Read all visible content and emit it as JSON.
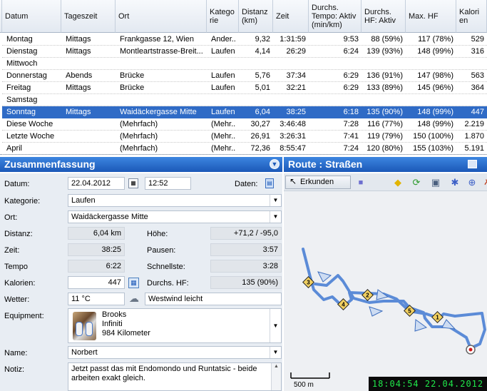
{
  "table": {
    "headers": [
      "Datum",
      "Tageszeit",
      "Ort",
      "Katego rie",
      "Distanz (km)",
      "Zeit",
      "Durchs. Tempo: Aktiv (min/km)",
      "Durchs. HF: Aktiv",
      "Max. HF",
      "Kalori en"
    ],
    "rows": [
      {
        "datum": "Montag",
        "tageszeit": "Mittags",
        "ort": "Frankgasse 12, Wien",
        "kategorie": "Ander...",
        "distanz": "9,32",
        "zeit": "1:31:59",
        "tempo": "9:53",
        "hf": "88 (59%)",
        "maxhf": "117 (78%)",
        "kal": "529"
      },
      {
        "datum": "Dienstag",
        "tageszeit": "Mittags",
        "ort": "Montleartstrasse-Breit...",
        "kategorie": "Laufen",
        "distanz": "4,14",
        "zeit": "26:29",
        "tempo": "6:24",
        "hf": "139 (93%)",
        "maxhf": "148 (99%)",
        "kal": "316"
      },
      {
        "datum": "Mittwoch",
        "tageszeit": "",
        "ort": "",
        "kategorie": "",
        "distanz": "",
        "zeit": "",
        "tempo": "",
        "hf": "",
        "maxhf": "",
        "kal": ""
      },
      {
        "datum": "Donnerstag",
        "tageszeit": "Abends",
        "ort": "Brücke",
        "kategorie": "Laufen",
        "distanz": "5,76",
        "zeit": "37:34",
        "tempo": "6:29",
        "hf": "136 (91%)",
        "maxhf": "147 (98%)",
        "kal": "563"
      },
      {
        "datum": "Freitag",
        "tageszeit": "Mittags",
        "ort": "Brücke",
        "kategorie": "Laufen",
        "distanz": "5,01",
        "zeit": "32:21",
        "tempo": "6:29",
        "hf": "133 (89%)",
        "maxhf": "145 (96%)",
        "kal": "364"
      },
      {
        "datum": "Samstag",
        "tageszeit": "",
        "ort": "",
        "kategorie": "",
        "distanz": "",
        "zeit": "",
        "tempo": "",
        "hf": "",
        "maxhf": "",
        "kal": ""
      },
      {
        "datum": "Sonntag",
        "tageszeit": "Mittags",
        "ort": "Waidäckergasse Mitte",
        "kategorie": "Laufen",
        "distanz": "6,04",
        "zeit": "38:25",
        "tempo": "6:18",
        "hf": "135 (90%)",
        "maxhf": "148 (99%)",
        "kal": "447"
      },
      {
        "datum": "Diese Woche",
        "tageszeit": "",
        "ort": "(Mehrfach)",
        "kategorie": "(Mehr...",
        "distanz": "30,27",
        "zeit": "3:46:48",
        "tempo": "7:28",
        "hf": "116 (77%)",
        "maxhf": "148 (99%)",
        "kal": "2.219"
      },
      {
        "datum": "Letzte Woche",
        "tageszeit": "",
        "ort": "(Mehrfach)",
        "kategorie": "(Mehr...",
        "distanz": "26,91",
        "zeit": "3:26:31",
        "tempo": "7:41",
        "hf": "119 (79%)",
        "maxhf": "150 (100%)",
        "kal": "1.870"
      },
      {
        "datum": "April",
        "tageszeit": "",
        "ort": "(Mehrfach)",
        "kategorie": "(Mehr...",
        "distanz": "72,36",
        "zeit": "8:55:47",
        "tempo": "7:24",
        "hf": "120 (80%)",
        "maxhf": "155 (103%)",
        "kal": "5.191"
      }
    ],
    "selected_index": 6
  },
  "summary": {
    "title": "Zusammenfassung",
    "datum_label": "Datum:",
    "datum_value": "22.04.2012",
    "time_value": "12:52",
    "daten_label": "Daten:",
    "kategorie_label": "Kategorie:",
    "kategorie_value": "Laufen",
    "ort_label": "Ort:",
    "ort_value": "Waidäckergasse Mitte",
    "distanz_label": "Distanz:",
    "distanz_value": "6,04 km",
    "hoehe_label": "Höhe:",
    "hoehe_value": "+71,2 / -95,0",
    "zeit_label": "Zeit:",
    "zeit_value": "38:25",
    "pausen_label": "Pausen:",
    "pausen_value": "3:57",
    "tempo_label": "Tempo",
    "tempo_value": "6:22",
    "schnellste_label": "Schnellste:",
    "schnellste_value": "3:28",
    "kalorien_label": "Kalorien:",
    "kalorien_value": "447",
    "hf_label": "Durchs. HF:",
    "hf_value": "135 (90%)",
    "wetter_label": "Wetter:",
    "wetter_temp": "11 °C",
    "wetter_wind": "Westwind leicht",
    "equipment_label": "Equipment:",
    "equipment_line1": "Brooks",
    "equipment_line2": "Infiniti",
    "equipment_line3": "984 Kilometer",
    "name_label": "Name:",
    "name_value": "Norbert",
    "notiz_label": "Notiz:",
    "notiz_value": "Jetzt passt das mit Endomondo und Runtatsic - beide arbeiten exakt gleich."
  },
  "map": {
    "title": "Route : Straßen",
    "erkunden_label": "Erkunden",
    "scale_label": "500 m",
    "clock": "18:04:54  22.04.2012",
    "markers": [
      "3",
      "4",
      "2",
      "5",
      "1"
    ]
  },
  "colors": {
    "selection": "#2f6bc6",
    "panel_header": "#1b58b8",
    "route": "#4a7fd4",
    "clock_text": "#20e84a"
  }
}
